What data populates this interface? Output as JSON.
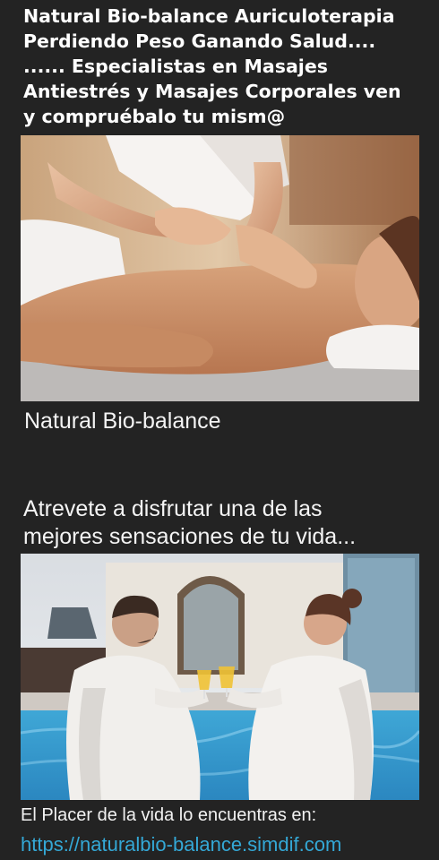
{
  "header": {
    "headline": "Natural Bio-balance Auriculoterapia\nPerdiendo Peso Ganando Salud....\n...... Especialistas en Masajes\nAntiestrés y Masajes Corporales ven\ny compruébalo tu mism@"
  },
  "images": {
    "massage": {
      "icon": "massage-photo"
    },
    "pool": {
      "icon": "pool-toast-photo"
    }
  },
  "main": {
    "caption": "Natural Bio-balance",
    "subheading": "Atrevete a disfrutar una de las\nmejores sensaciones de tu vida..."
  },
  "footer": {
    "text": "El Placer de la vida lo encuentras en:",
    "link": "https://naturalbio-balance.simdif.com",
    "link_color": "#34a8d6"
  },
  "colors": {
    "background": "#232323",
    "text": "#ffffff"
  }
}
